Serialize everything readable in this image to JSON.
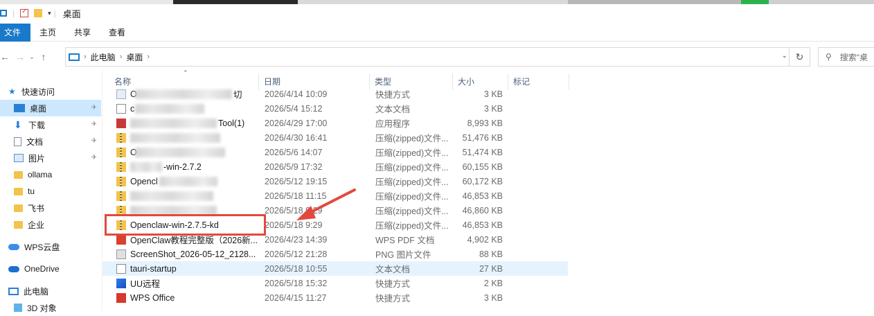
{
  "window": {
    "title": "桌面"
  },
  "ribbon": {
    "tabs": [
      "文件",
      "主页",
      "共享",
      "查看"
    ]
  },
  "address": {
    "crumbs": [
      "此电脑",
      "桌面"
    ],
    "search_placeholder": "搜索\"桌"
  },
  "sidebar": {
    "quick_access": "快速访问",
    "items": [
      {
        "label": "桌面",
        "icon": "desktop-icon",
        "pinned": true,
        "selected": true
      },
      {
        "label": "下载",
        "icon": "download-icon",
        "pinned": true
      },
      {
        "label": "文档",
        "icon": "document-icon",
        "pinned": true
      },
      {
        "label": "图片",
        "icon": "picture-icon",
        "pinned": true
      },
      {
        "label": "ollama",
        "icon": "folder-icon"
      },
      {
        "label": "tu",
        "icon": "folder-icon"
      },
      {
        "label": "飞书",
        "icon": "folder-icon"
      },
      {
        "label": "企业",
        "icon": "folder-icon"
      }
    ],
    "wps_cloud": "WPS云盘",
    "onedrive": "OneDrive",
    "this_pc": "此电脑",
    "objects3d": "3D 对象"
  },
  "columns": {
    "name": "名称",
    "date": "日期",
    "type": "类型",
    "size": "大小",
    "tags": "标记"
  },
  "files": [
    {
      "name": "O",
      "suffix": "切",
      "date": "2026/4/14 10:09",
      "type": "快捷方式",
      "size": "3 KB",
      "icon": "shortcut-icon",
      "blurred": true
    },
    {
      "name": "c",
      "suffix": "",
      "date": "2026/5/4 15:12",
      "type": "文本文档",
      "size": "3 KB",
      "icon": "text-file-icon",
      "blurred": true
    },
    {
      "name": "",
      "suffix": "Tool(1)",
      "date": "2026/4/29 17:00",
      "type": "应用程序",
      "size": "8,993 KB",
      "icon": "app-icon",
      "blurred": true
    },
    {
      "name": "",
      "suffix": "",
      "date": "2026/4/30 16:41",
      "type": "压缩(zipped)文件...",
      "size": "51,476 KB",
      "icon": "zip-icon",
      "blurred": true
    },
    {
      "name": "O",
      "suffix": "",
      "date": "2026/5/6 14:07",
      "type": "压缩(zipped)文件...",
      "size": "51,474 KB",
      "icon": "zip-icon",
      "blurred": true
    },
    {
      "name": "",
      "suffix": "-win-2.7.2",
      "date": "2026/5/9 17:32",
      "type": "压缩(zipped)文件...",
      "size": "60,155 KB",
      "icon": "zip-icon",
      "blurred": true
    },
    {
      "name": "Opencl",
      "suffix": "",
      "date": "2026/5/12 19:15",
      "type": "压缩(zipped)文件...",
      "size": "60,172 KB",
      "icon": "zip-icon",
      "blurred": true
    },
    {
      "name": "",
      "suffix": "",
      "date": "2026/5/18 11:15",
      "type": "压缩(zipped)文件...",
      "size": "46,853 KB",
      "icon": "zip-icon",
      "blurred": true
    },
    {
      "name": "",
      "suffix": "",
      "date": "2026/5/18 9:29",
      "type": "压缩(zipped)文件...",
      "size": "46,860 KB",
      "icon": "zip-icon",
      "blurred": true
    },
    {
      "name": "Openclaw-win-2.7.5-kd",
      "suffix": "",
      "date": "2026/5/18 9:29",
      "type": "压缩(zipped)文件...",
      "size": "46,853 KB",
      "icon": "zip-icon"
    },
    {
      "name": "OpenClaw教程完整版（2026新...",
      "suffix": "",
      "date": "2026/4/23 14:39",
      "type": "WPS PDF 文档",
      "size": "4,902 KB",
      "icon": "pdf-icon"
    },
    {
      "name": "ScreenShot_2026-05-12_2128...",
      "suffix": "",
      "date": "2026/5/12 21:28",
      "type": "PNG 图片文件",
      "size": "88 KB",
      "icon": "png-icon"
    },
    {
      "name": "tauri-startup",
      "suffix": "",
      "date": "2026/5/18 10:55",
      "type": "文本文档",
      "size": "27 KB",
      "icon": "text-file-icon",
      "highlighted": true
    },
    {
      "name": "UU远程",
      "suffix": "",
      "date": "2026/5/18 15:32",
      "type": "快捷方式",
      "size": "2 KB",
      "icon": "uu-remote-icon"
    },
    {
      "name": "WPS Office",
      "suffix": "",
      "date": "2026/4/15 11:27",
      "type": "快捷方式",
      "size": "3 KB",
      "icon": "wps-icon"
    }
  ],
  "colors": {
    "accent": "#1979ca",
    "selection": "#cce8ff",
    "hover": "#e5f3ff",
    "annotation": "#e2493e"
  }
}
